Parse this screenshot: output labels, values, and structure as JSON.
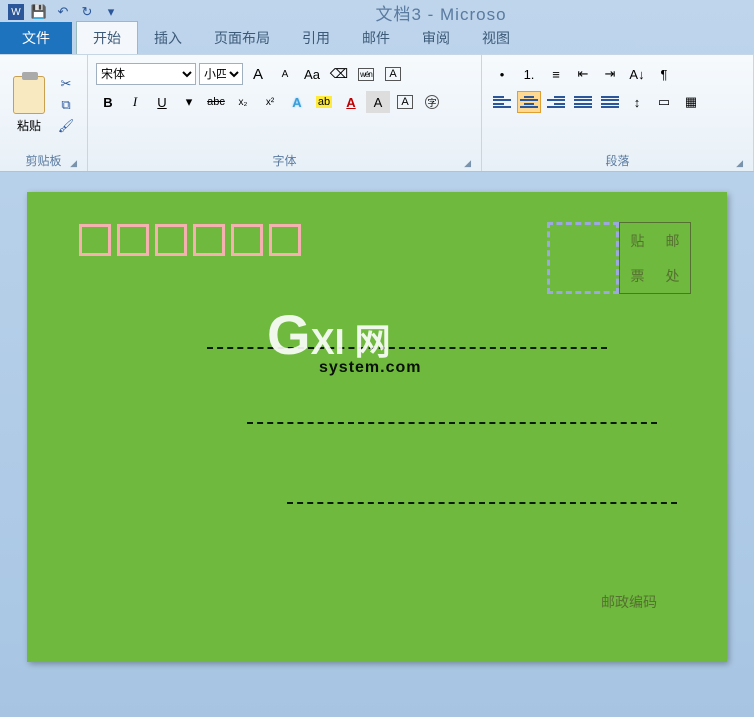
{
  "title": "文档3 - Microso",
  "qat": {
    "word": "W",
    "save": "💾",
    "undo": "↶",
    "redo": "↻"
  },
  "file": "文件",
  "tabs": [
    "开始",
    "插入",
    "页面布局",
    "引用",
    "邮件",
    "审阅",
    "视图"
  ],
  "clipboard": {
    "label": "剪贴板",
    "paste": "粘贴"
  },
  "font": {
    "label": "字体",
    "name": "宋体",
    "size": "小四",
    "grow": "A",
    "shrink": "A",
    "caps": "Aa",
    "clear": "⌫",
    "phonetic": "wén",
    "charborder": "A",
    "bold": "B",
    "italic": "I",
    "underline": "U",
    "strike": "abc",
    "sub": "x₂",
    "sup": "x²",
    "effect": "A",
    "highlight": "ab",
    "color": "A",
    "shade": "A",
    "box": "A",
    "circle": "字"
  },
  "para": {
    "label": "段落",
    "bullets": "•",
    "numbers": "1.",
    "multilevel": "≡",
    "dedent": "⇤",
    "indent": "⇥",
    "sort": "A↓",
    "marks": "¶",
    "linespace": "↕",
    "shading": "▭",
    "borders": "▦"
  },
  "doc": {
    "stamp": [
      "贴",
      "邮",
      "票",
      "处"
    ],
    "postlabel": "邮政编码"
  },
  "watermark": {
    "big": "G",
    "text": "XI 网",
    "sub": "system.com"
  }
}
